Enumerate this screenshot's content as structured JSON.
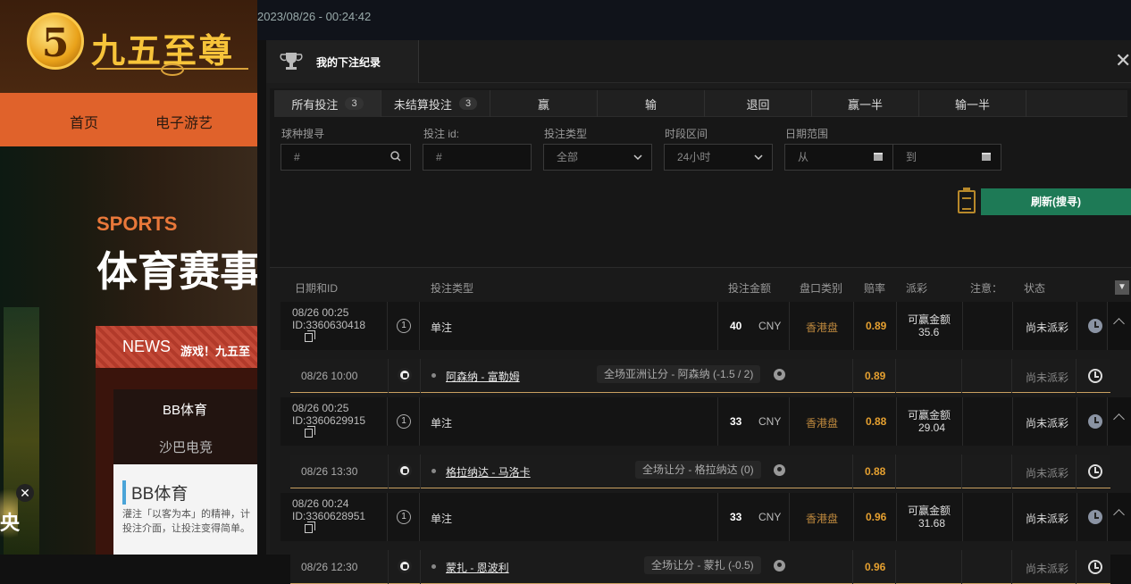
{
  "site": {
    "logo_digit": "5",
    "logo_text": "九五至尊",
    "nav": [
      "首页",
      "电子游艺"
    ],
    "sports_label": "SPORTS",
    "sports_title": "体育赛事",
    "news_label": "NEWS",
    "news_text": "游戏！九五至",
    "tab_bb": "BB体育",
    "tab_saba": "沙巴电竞",
    "card_title": "BB体育",
    "card_desc": "灌注「以客为本」的精神，计投注介面，让投注变得简单。",
    "float_char": "央"
  },
  "top_time": "2023/08/26 - 00:24:42",
  "modal": {
    "title": "我的下注纪录",
    "close": "✕",
    "tabs": [
      {
        "label": "所有投注",
        "count": "3"
      },
      {
        "label": "未结算投注",
        "count": "3"
      },
      {
        "label": "赢",
        "count": ""
      },
      {
        "label": "输",
        "count": ""
      },
      {
        "label": "退回",
        "count": ""
      },
      {
        "label": "赢一半",
        "count": ""
      },
      {
        "label": "输一半",
        "count": ""
      }
    ],
    "filters": {
      "sport_label": "球种搜寻",
      "sport_placeholder": "#",
      "betid_label": "投注 id:",
      "betid_placeholder": "#",
      "bettype_label": "投注类型",
      "bettype_value": "全部",
      "period_label": "时段区间",
      "period_value": "24小时",
      "daterange_label": "日期范围",
      "date_from": "从",
      "date_to": "到"
    },
    "refresh_label": "刷新(搜寻)",
    "columns": [
      "日期和ID",
      "投注类型",
      "投注金额",
      "盘口类别",
      "赔率",
      "派彩",
      "注意：",
      "状态"
    ],
    "bets": [
      {
        "date": "08/26 00:25",
        "id": "ID:3360630418",
        "type": "单注",
        "amount": "40",
        "currency": "CNY",
        "market": "香港盘",
        "odds": "0.89",
        "payout_label": "可赢金额",
        "payout": "35.6",
        "status": "尚未派彩",
        "sel": {
          "date": "08/26 10:00",
          "teams": "阿森纳 - 富勒姆",
          "market": "全场亚洲让分 - 阿森纳 (-1.5 / 2)",
          "odds": "0.89",
          "status": "尚未派彩"
        }
      },
      {
        "date": "08/26 00:25",
        "id": "ID:3360629915",
        "type": "单注",
        "amount": "33",
        "currency": "CNY",
        "market": "香港盘",
        "odds": "0.88",
        "payout_label": "可赢金额",
        "payout": "29.04",
        "status": "尚未派彩",
        "sel": {
          "date": "08/26 13:30",
          "teams": "格拉纳达 - 马洛卡",
          "market": "全场让分 - 格拉纳达 (0)",
          "odds": "0.88",
          "status": "尚未派彩"
        }
      },
      {
        "date": "08/26 00:24",
        "id": "ID:3360628951",
        "type": "单注",
        "amount": "33",
        "currency": "CNY",
        "market": "香港盘",
        "odds": "0.96",
        "payout_label": "可赢金额",
        "payout": "31.68",
        "status": "尚未派彩",
        "sel": {
          "date": "08/26 12:30",
          "teams": "蒙扎 - 恩波利",
          "market": "全场让分 - 蒙扎 (-0.5)",
          "odds": "0.96",
          "status": "尚未派彩"
        }
      }
    ]
  },
  "colors": {
    "accent_green": "#1e7a56",
    "odds_orange": "#e5a030",
    "market_brown": "#c08a3e",
    "nav_orange": "#e0622b"
  },
  "icons": [
    "trophy-icon",
    "close-icon",
    "search-icon",
    "chevron-down-icon",
    "calendar-icon",
    "clipboard-icon",
    "copy-icon",
    "clock-icon",
    "soccer-ball-icon",
    "user-icon",
    "chevron-up-icon"
  ]
}
